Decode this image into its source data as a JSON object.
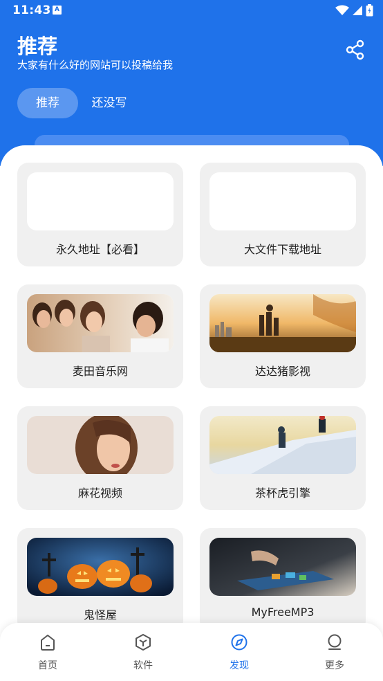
{
  "status_bar": {
    "time": "11:43",
    "notif_letter": "A"
  },
  "header": {
    "title": "推荐",
    "subtitle": "大家有什么好的网站可以投稿给我",
    "tabs": [
      {
        "label": "推荐",
        "active": true
      },
      {
        "label": "还没写",
        "active": false
      }
    ]
  },
  "cards": [
    {
      "label": "永久地址【必看】",
      "thumb": "blank"
    },
    {
      "label": "大文件下载地址",
      "thumb": "blank"
    },
    {
      "label": "麦田音乐网",
      "thumb": "friends-photo"
    },
    {
      "label": "达达猪影视",
      "thumb": "family-sunset-photo"
    },
    {
      "label": "麻花视频",
      "thumb": "woman-portrait-photo"
    },
    {
      "label": "茶杯虎引擎",
      "thumb": "climbers-photo"
    },
    {
      "label": "鬼怪屋",
      "thumb": "halloween-pumpkins-photo"
    },
    {
      "label": "MyFreeMP3",
      "thumb": "laptop-hand-photo"
    }
  ],
  "bottom_nav": [
    {
      "label": "首页",
      "icon": "home-icon",
      "active": false
    },
    {
      "label": "软件",
      "icon": "cube-icon",
      "active": false
    },
    {
      "label": "发现",
      "icon": "compass-icon",
      "active": true
    },
    {
      "label": "更多",
      "icon": "profile-icon",
      "active": false
    }
  ],
  "colors": {
    "primary": "#1f72ea",
    "card_bg": "#f0f0f0",
    "tab_active_bg": "#5b97f0"
  }
}
